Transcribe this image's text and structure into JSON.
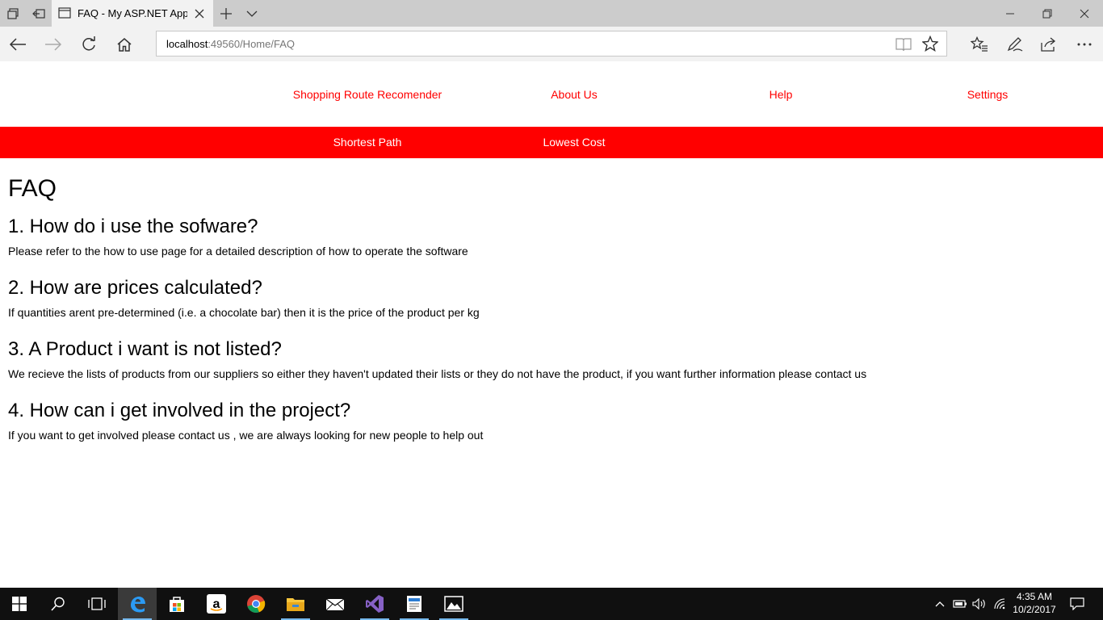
{
  "browser": {
    "tab_title": "FAQ - My ASP.NET Appl",
    "url_host": "localhost",
    "url_rest": ":49560/Home/FAQ"
  },
  "nav": {
    "links": [
      "Shopping Route Recomender",
      "About Us",
      "Help",
      "Settings"
    ]
  },
  "subnav": {
    "links": [
      "Shortest Path",
      "Lowest Cost"
    ]
  },
  "content": {
    "title": "FAQ",
    "faqs": [
      {
        "q": "1. How do i use the sofware?",
        "a": "Please refer to the how to use page for a detailed description of how to operate the software"
      },
      {
        "q": "2. How are prices calculated?",
        "a": "If quantities arent pre-determined (i.e. a chocolate bar) then it is the price of the product per kg"
      },
      {
        "q": "3. A Product i want is not listed?",
        "a": "We recieve the lists of products from our suppliers so either they haven't updated their lists or they do not have the product, if you want further information please contact us"
      },
      {
        "q": "4. How can i get involved in the project?",
        "a": "If you want to get involved please contact us , we are always looking for new people to help out"
      }
    ]
  },
  "taskbar": {
    "time": "4:35 AM",
    "date": "10/2/2017"
  },
  "colors": {
    "accent": "#ff0000",
    "tabbar": "#cccccc",
    "addressbar": "#f2f2f2",
    "taskbar": "#101010"
  }
}
